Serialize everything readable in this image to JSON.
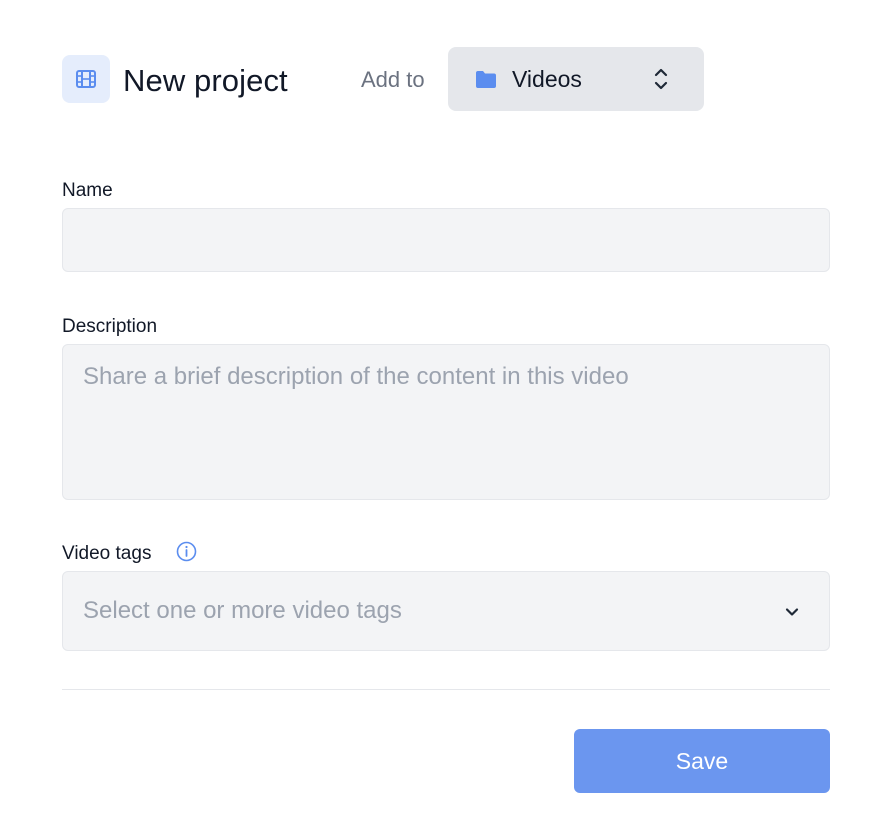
{
  "header": {
    "title": "New project",
    "add_to_label": "Add to",
    "folder": {
      "selected": "Videos",
      "icon": "folder-icon"
    },
    "project_icon": "film-icon"
  },
  "form": {
    "name": {
      "label": "Name",
      "value": "",
      "placeholder": ""
    },
    "description": {
      "label": "Description",
      "value": "",
      "placeholder": "Share a brief description of the content in this video"
    },
    "video_tags": {
      "label": "Video tags",
      "placeholder": "Select one or more video tags",
      "info_icon": "info-icon",
      "dropdown_icon": "chevron-down-icon"
    }
  },
  "actions": {
    "save_label": "Save"
  },
  "colors": {
    "accent": "#6b96ef",
    "icon_blue": "#5b8def",
    "icon_bg": "#e5edfc",
    "input_bg": "#f3f4f6",
    "select_bg": "#e5e7eb"
  }
}
